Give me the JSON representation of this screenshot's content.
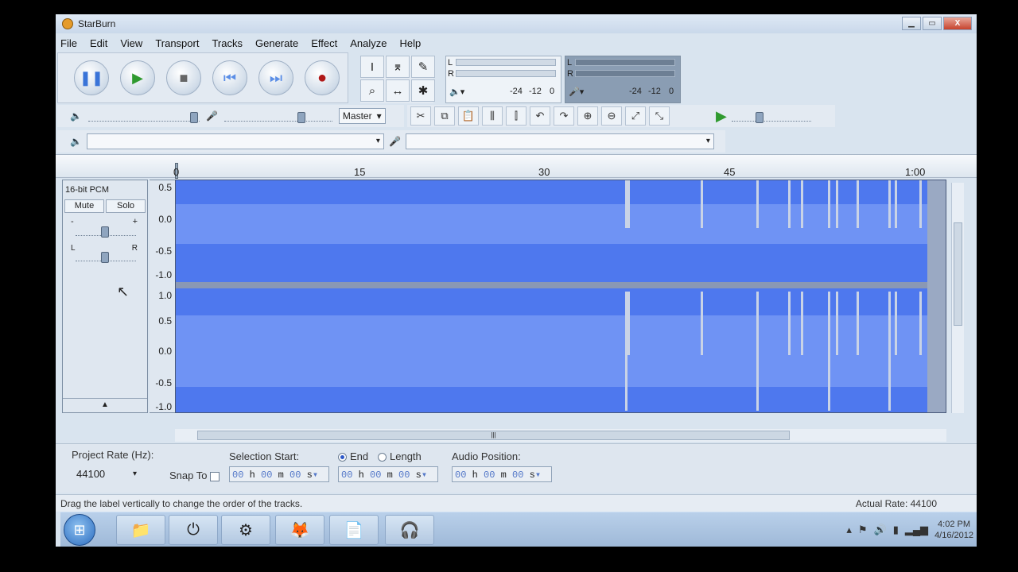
{
  "window": {
    "title": "StarBurn",
    "min": "▁",
    "max": "▭",
    "close": "X"
  },
  "menu": [
    "File",
    "Edit",
    "View",
    "Transport",
    "Tracks",
    "Generate",
    "Effect",
    "Analyze",
    "Help"
  ],
  "transport": {
    "pause": "❚❚",
    "play": "▶",
    "stop": "■",
    "skip_start": "⏮",
    "skip_end": "⏭",
    "record": "●"
  },
  "meters": {
    "play_l": "L",
    "play_r": "R",
    "scale": [
      "-24",
      "-12",
      "0"
    ],
    "rec_l": "L",
    "rec_r": "R"
  },
  "mixer": {
    "volume_plus": "+",
    "volume_minus": "-",
    "source": "Master"
  },
  "ruler": {
    "ticks": [
      {
        "label": "0"
      },
      {
        "label": "15"
      },
      {
        "label": "30"
      },
      {
        "label": "45"
      },
      {
        "label": "1:00"
      }
    ]
  },
  "track": {
    "format": "16-bit PCM",
    "mute": "Mute",
    "solo": "Solo",
    "gain_minus": "-",
    "gain_plus": "+",
    "pan_left": "L",
    "pan_right": "R",
    "collapse": "▲",
    "scale_top": [
      "0.5",
      "0.0",
      "-0.5",
      "-1.0"
    ],
    "scale_bottom": [
      "1.0",
      "0.5",
      "0.0",
      "-0.5",
      "-1.0"
    ]
  },
  "selection": {
    "project_rate_label": "Project Rate (Hz):",
    "project_rate": "44100",
    "snap_to": "Snap To",
    "selection_start_label": "Selection Start:",
    "end_label": "End",
    "length_label": "Length",
    "audio_position_label": "Audio Position:",
    "start_time": [
      "00",
      "h",
      "00",
      "m",
      "00",
      "s"
    ],
    "end_time": [
      "00",
      "h",
      "00",
      "m",
      "00",
      "s"
    ],
    "audio_time": [
      "00",
      "h",
      "00",
      "m",
      "00",
      "s"
    ]
  },
  "status": {
    "message": "Drag the label vertically to change the order of the tracks.",
    "actual_rate": "Actual Rate: 44100"
  },
  "taskbar": {
    "time": "4:02 PM",
    "date": "4/16/2012"
  }
}
